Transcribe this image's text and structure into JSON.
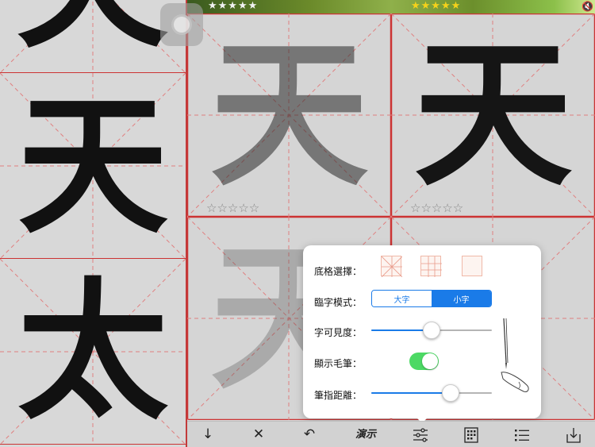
{
  "top_banner": {
    "stars_left": "★★★★★",
    "stars_right": "★★★★★",
    "speaker_icon": "speaker-mute-icon"
  },
  "reference_column": {
    "characters": [
      "夭",
      "天",
      "太"
    ]
  },
  "practice_grid": {
    "cells": [
      {
        "char": "天",
        "opacity": 0.5,
        "rating": "☆☆☆☆☆"
      },
      {
        "char": "天",
        "opacity": 0.95,
        "rating": "☆☆☆☆☆"
      },
      {
        "char": "天",
        "opacity": 0.3,
        "rating": ""
      },
      {
        "char": "",
        "opacity": 0,
        "rating": ""
      }
    ]
  },
  "settings": {
    "grid_select_label": "底格選擇：",
    "grid_options": [
      "米字格",
      "田字格",
      "空白格"
    ],
    "copy_mode_label": "臨字模式：",
    "copy_mode_options": [
      "大字",
      "小字"
    ],
    "copy_mode_selected": "小字",
    "visibility_label": "字可見度：",
    "visibility_value": 0.5,
    "show_brush_label": "顯示毛筆：",
    "show_brush_on": true,
    "finger_distance_label": "筆指距離：",
    "finger_distance_value": 0.66
  },
  "toolbar": {
    "down_icon": "↓",
    "close_icon": "✕",
    "undo_icon": "↶",
    "demo_label": "演示",
    "settings_icon": "☰",
    "grid_icon": "▦",
    "list_icon": "☰",
    "download_icon": "⤓"
  },
  "colors": {
    "grid_red": "#cc3333",
    "accent_blue": "#1a7be8",
    "toggle_green": "#4cd964"
  }
}
